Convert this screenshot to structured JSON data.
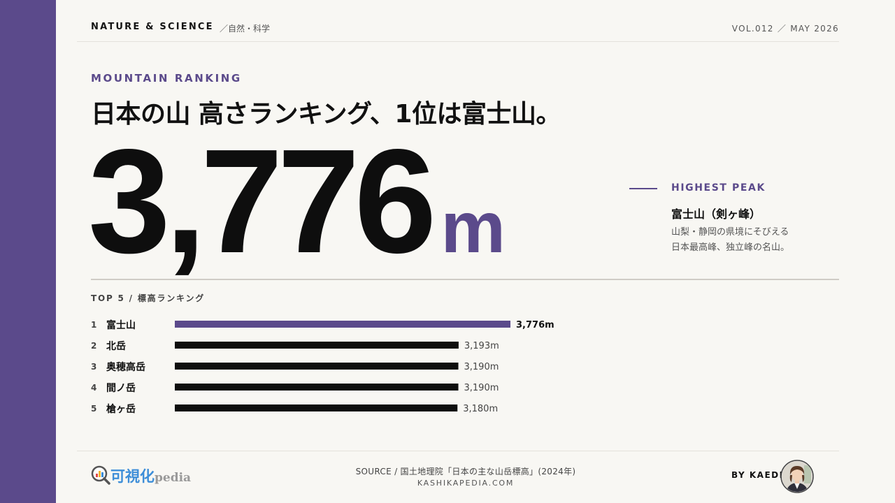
{
  "header": {
    "category": "NATURE & SCIENCE",
    "category_ja": "／自然・科学",
    "volume": "VOL.012 ／ MAY 2026"
  },
  "hero": {
    "eyebrow": "MOUNTAIN RANKING",
    "headline": "日本の山 高さランキング、1位は富士山。",
    "number": "3,776",
    "unit": "m"
  },
  "highlight": {
    "label": "HIGHEST PEAK",
    "name": "富士山（剣ヶ峰）",
    "desc_line1": "山梨・静岡の県境にそびえる",
    "desc_line2": "日本最高峰、独立峰の名山。"
  },
  "chart_title": "TOP 5 / 標高ランキング",
  "chart_data": {
    "type": "bar",
    "orientation": "horizontal",
    "ranks": [
      "1",
      "2",
      "3",
      "4",
      "5"
    ],
    "categories": [
      "富士山",
      "北岳",
      "奥穂高岳",
      "間ノ岳",
      "槍ヶ岳"
    ],
    "values": [
      3776,
      3193,
      3190,
      3190,
      3180
    ],
    "value_labels": [
      "3,776m",
      "3,193m",
      "3,190m",
      "3,190m",
      "3,180m"
    ],
    "unit": "m",
    "highlight_color": "#5b4a8b",
    "bar_color": "#0e0e0e",
    "grid": false
  },
  "footer": {
    "logo_ja": "可視化",
    "logo_en": "pedia",
    "source": "SOURCE / 国土地理院「日本の主な山岳標高」(2024年)",
    "site": "KASHIKAPEDIA.COM",
    "byline": "BY KAEDE"
  },
  "colors": {
    "accent": "#5b4a8b",
    "background": "#f8f7f3",
    "text": "#141414"
  }
}
